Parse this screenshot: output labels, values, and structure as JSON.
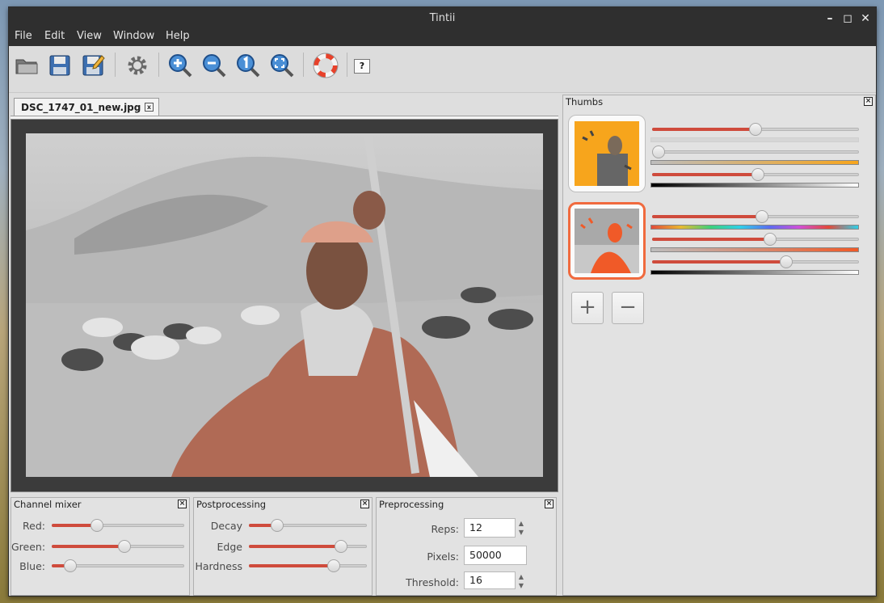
{
  "window": {
    "title": "Tintii"
  },
  "menu": [
    "File",
    "Edit",
    "View",
    "Window",
    "Help"
  ],
  "toolbar": {
    "icons": [
      "open-folder-icon",
      "save-icon",
      "save-as-icon",
      "settings-gear-icon",
      "zoom-in-icon",
      "zoom-out-icon",
      "zoom-actual-icon",
      "zoom-fit-icon",
      "help-lifebuoy-icon",
      "about-question-icon"
    ],
    "about_label": "?"
  },
  "document": {
    "tab_label": "DSC_1747_01_new.jpg",
    "tab_close": "x"
  },
  "channel_mixer": {
    "title": "Channel mixer",
    "sliders": [
      {
        "label": "Red:",
        "value": 0.34
      },
      {
        "label": "Green:",
        "value": 0.55
      },
      {
        "label": "Blue:",
        "value": 0.14
      }
    ]
  },
  "postprocessing": {
    "title": "Postprocessing",
    "sliders": [
      {
        "label": "Decay",
        "value": 0.24
      },
      {
        "label": "Edge",
        "value": 0.78
      },
      {
        "label": "Hardness",
        "value": 0.72
      }
    ]
  },
  "preprocessing": {
    "title": "Preprocessing",
    "reps": {
      "label": "Reps:",
      "value": "12"
    },
    "pixels": {
      "label": "Pixels:",
      "value": "50000"
    },
    "threshold": {
      "label": "Threshold:",
      "value": "16"
    }
  },
  "thumbs": {
    "title": "Thumbs",
    "items": [
      {
        "color": "#f7a51c",
        "selected": false,
        "hue": 0.5,
        "saturation": 0.02,
        "value": 0.51
      },
      {
        "color": "#f05a28",
        "selected": true,
        "hue": 0.53,
        "saturation": 0.57,
        "value": 0.65
      }
    ],
    "add_label": "+",
    "remove_label": "−"
  },
  "colors": {
    "accent": "#cf4b3c",
    "titlebar": "#2f2f2f",
    "selected_border": "#f06a3e"
  }
}
